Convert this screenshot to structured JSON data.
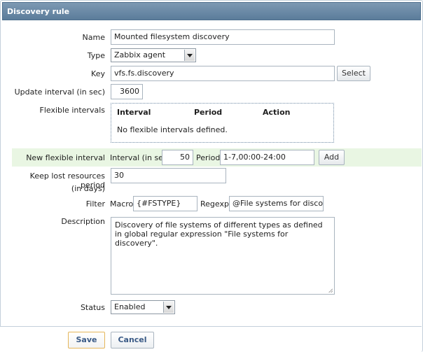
{
  "window": {
    "title": "Discovery rule"
  },
  "form": {
    "name": {
      "label": "Name",
      "value": "Mounted filesystem discovery"
    },
    "type": {
      "label": "Type",
      "value": "Zabbix agent"
    },
    "key": {
      "label": "Key",
      "value": "vfs.fs.discovery",
      "select_label": "Select"
    },
    "update_interval": {
      "label": "Update interval (in sec)",
      "value": "3600"
    },
    "flexible_intervals": {
      "label": "Flexible intervals",
      "columns": [
        "Interval",
        "Period",
        "Action"
      ],
      "empty_text": "No flexible intervals defined."
    },
    "new_flexible_interval": {
      "label": "New flexible interval",
      "interval_label": "Interval (in sec)",
      "interval_value": "50",
      "period_label": "Period",
      "period_value": "1-7,00:00-24:00",
      "add_label": "Add"
    },
    "keep_lost": {
      "label_line1": "Keep lost resources period",
      "label_line2": "(in days)",
      "value": "30"
    },
    "filter": {
      "label": "Filter",
      "macro_label": "Macro",
      "macro_value": "{#FSTYPE}",
      "regexp_label": "Regexp",
      "regexp_value": "@File systems for discovery"
    },
    "description": {
      "label": "Description",
      "value": "Discovery of file systems of different types as defined in global regular expression \"File systems for discovery\"."
    },
    "status": {
      "label": "Status",
      "value": "Enabled"
    }
  },
  "footer": {
    "save_label": "Save",
    "cancel_label": "Cancel"
  }
}
